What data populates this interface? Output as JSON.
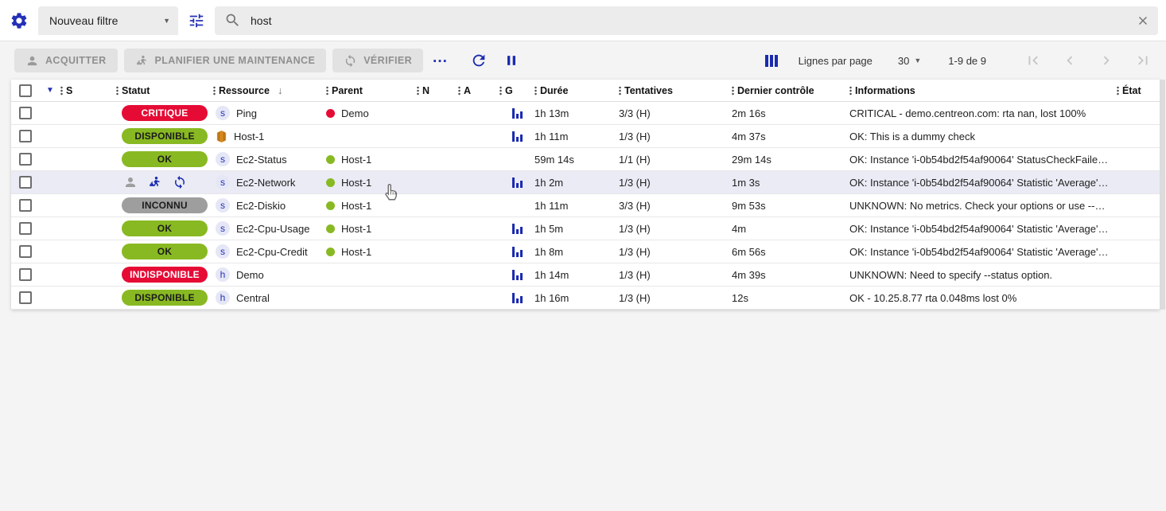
{
  "colors": {
    "accent": "#2430b6",
    "ok_green": "#88b922",
    "critical_red": "#e60b35",
    "unknown_gray": "#9e9e9e"
  },
  "filter_bar": {
    "filter_select_value": "Nouveau filtre",
    "search_value": "host"
  },
  "toolbar": {
    "acknowledge_label": "ACQUITTER",
    "maintenance_label": "PLANIFIER UNE MAINTENANCE",
    "check_label": "VÉRIFIER",
    "more_label": "...",
    "rows_per_page_label": "Lignes par page",
    "rows_per_page_value": "30",
    "page_range": "1-9 de 9"
  },
  "table": {
    "headers": {
      "s": "S",
      "status": "Statut",
      "resource": "Ressource",
      "parent": "Parent",
      "n": "N",
      "a": "A",
      "g": "G",
      "duration": "Durée",
      "tries": "Tentatives",
      "last_check": "Dernier contrôle",
      "information": "Informations",
      "state": "État"
    },
    "rows": [
      {
        "status": {
          "kind": "chip",
          "label": "CRITIQUE",
          "bg": "#e60b35",
          "fg": "#ffffff"
        },
        "type": "s",
        "resource": "Ping",
        "parent": {
          "label": "Demo",
          "color": "#e60b35"
        },
        "graph": true,
        "duration": "1h 13m",
        "tries": "3/3 (H)",
        "last_check": "2m 16s",
        "info": "CRITICAL - demo.centreon.com: rta nan, lost 100%",
        "hovered": false
      },
      {
        "status": {
          "kind": "chip",
          "label": "DISPONIBLE",
          "bg": "#88b922",
          "fg": "#1b1b1b"
        },
        "type": "box",
        "resource": "Host-1",
        "parent": null,
        "graph": true,
        "duration": "1h 11m",
        "tries": "1/3 (H)",
        "last_check": "4m 37s",
        "info": "OK: This is a dummy check",
        "hovered": false
      },
      {
        "status": {
          "kind": "chip",
          "label": "OK",
          "bg": "#88b922",
          "fg": "#1b1b1b"
        },
        "type": "s",
        "resource": "Ec2-Status",
        "parent": {
          "label": "Host-1",
          "color": "#88b922"
        },
        "graph": false,
        "duration": "59m 14s",
        "tries": "1/1 (H)",
        "last_check": "29m 14s",
        "info": "OK: Instance 'i-0b54bd2f54af90064' StatusCheckFailed_...",
        "hovered": false
      },
      {
        "status": {
          "kind": "icons",
          "icons": [
            "acknowledged",
            "in-downtime",
            "refreshing"
          ]
        },
        "type": "s",
        "resource": "Ec2-Network",
        "parent": {
          "label": "Host-1",
          "color": "#88b922"
        },
        "graph": true,
        "duration": "1h 2m",
        "tries": "1/3 (H)",
        "last_check": "1m 3s",
        "info": "OK: Instance 'i-0b54bd2f54af90064' Statistic 'Average' M...",
        "hovered": true
      },
      {
        "status": {
          "kind": "chip",
          "label": "INCONNU",
          "bg": "#9e9e9e",
          "fg": "#1b1b1b"
        },
        "type": "s",
        "resource": "Ec2-Diskio",
        "parent": {
          "label": "Host-1",
          "color": "#88b922"
        },
        "graph": false,
        "duration": "1h 11m",
        "tries": "3/3 (H)",
        "last_check": "9m 53s",
        "info": "UNKNOWN: No metrics. Check your options or use --zer...",
        "hovered": false
      },
      {
        "status": {
          "kind": "chip",
          "label": "OK",
          "bg": "#88b922",
          "fg": "#1b1b1b"
        },
        "type": "s",
        "resource": "Ec2-Cpu-Usage",
        "parent": {
          "label": "Host-1",
          "color": "#88b922"
        },
        "graph": true,
        "duration": "1h 5m",
        "tries": "1/3 (H)",
        "last_check": "4m",
        "info": "OK: Instance 'i-0b54bd2f54af90064' Statistic 'Average' M...",
        "hovered": false
      },
      {
        "status": {
          "kind": "chip",
          "label": "OK",
          "bg": "#88b922",
          "fg": "#1b1b1b"
        },
        "type": "s",
        "resource": "Ec2-Cpu-Credit",
        "parent": {
          "label": "Host-1",
          "color": "#88b922"
        },
        "graph": true,
        "duration": "1h 8m",
        "tries": "1/3 (H)",
        "last_check": "6m 56s",
        "info": "OK: Instance 'i-0b54bd2f54af90064' Statistic 'Average' M...",
        "hovered": false
      },
      {
        "status": {
          "kind": "chip",
          "label": "INDISPONIBLE",
          "bg": "#e60b35",
          "fg": "#ffffff"
        },
        "type": "h",
        "resource": "Demo",
        "parent": null,
        "graph": true,
        "duration": "1h 14m",
        "tries": "1/3 (H)",
        "last_check": "4m 39s",
        "info": "UNKNOWN: Need to specify --status option.",
        "hovered": false
      },
      {
        "status": {
          "kind": "chip",
          "label": "DISPONIBLE",
          "bg": "#88b922",
          "fg": "#1b1b1b"
        },
        "type": "h",
        "resource": "Central",
        "parent": null,
        "graph": true,
        "duration": "1h 16m",
        "tries": "1/3 (H)",
        "last_check": "12s",
        "info": "OK - 10.25.8.77 rta 0.048ms lost 0%",
        "hovered": false
      }
    ]
  }
}
